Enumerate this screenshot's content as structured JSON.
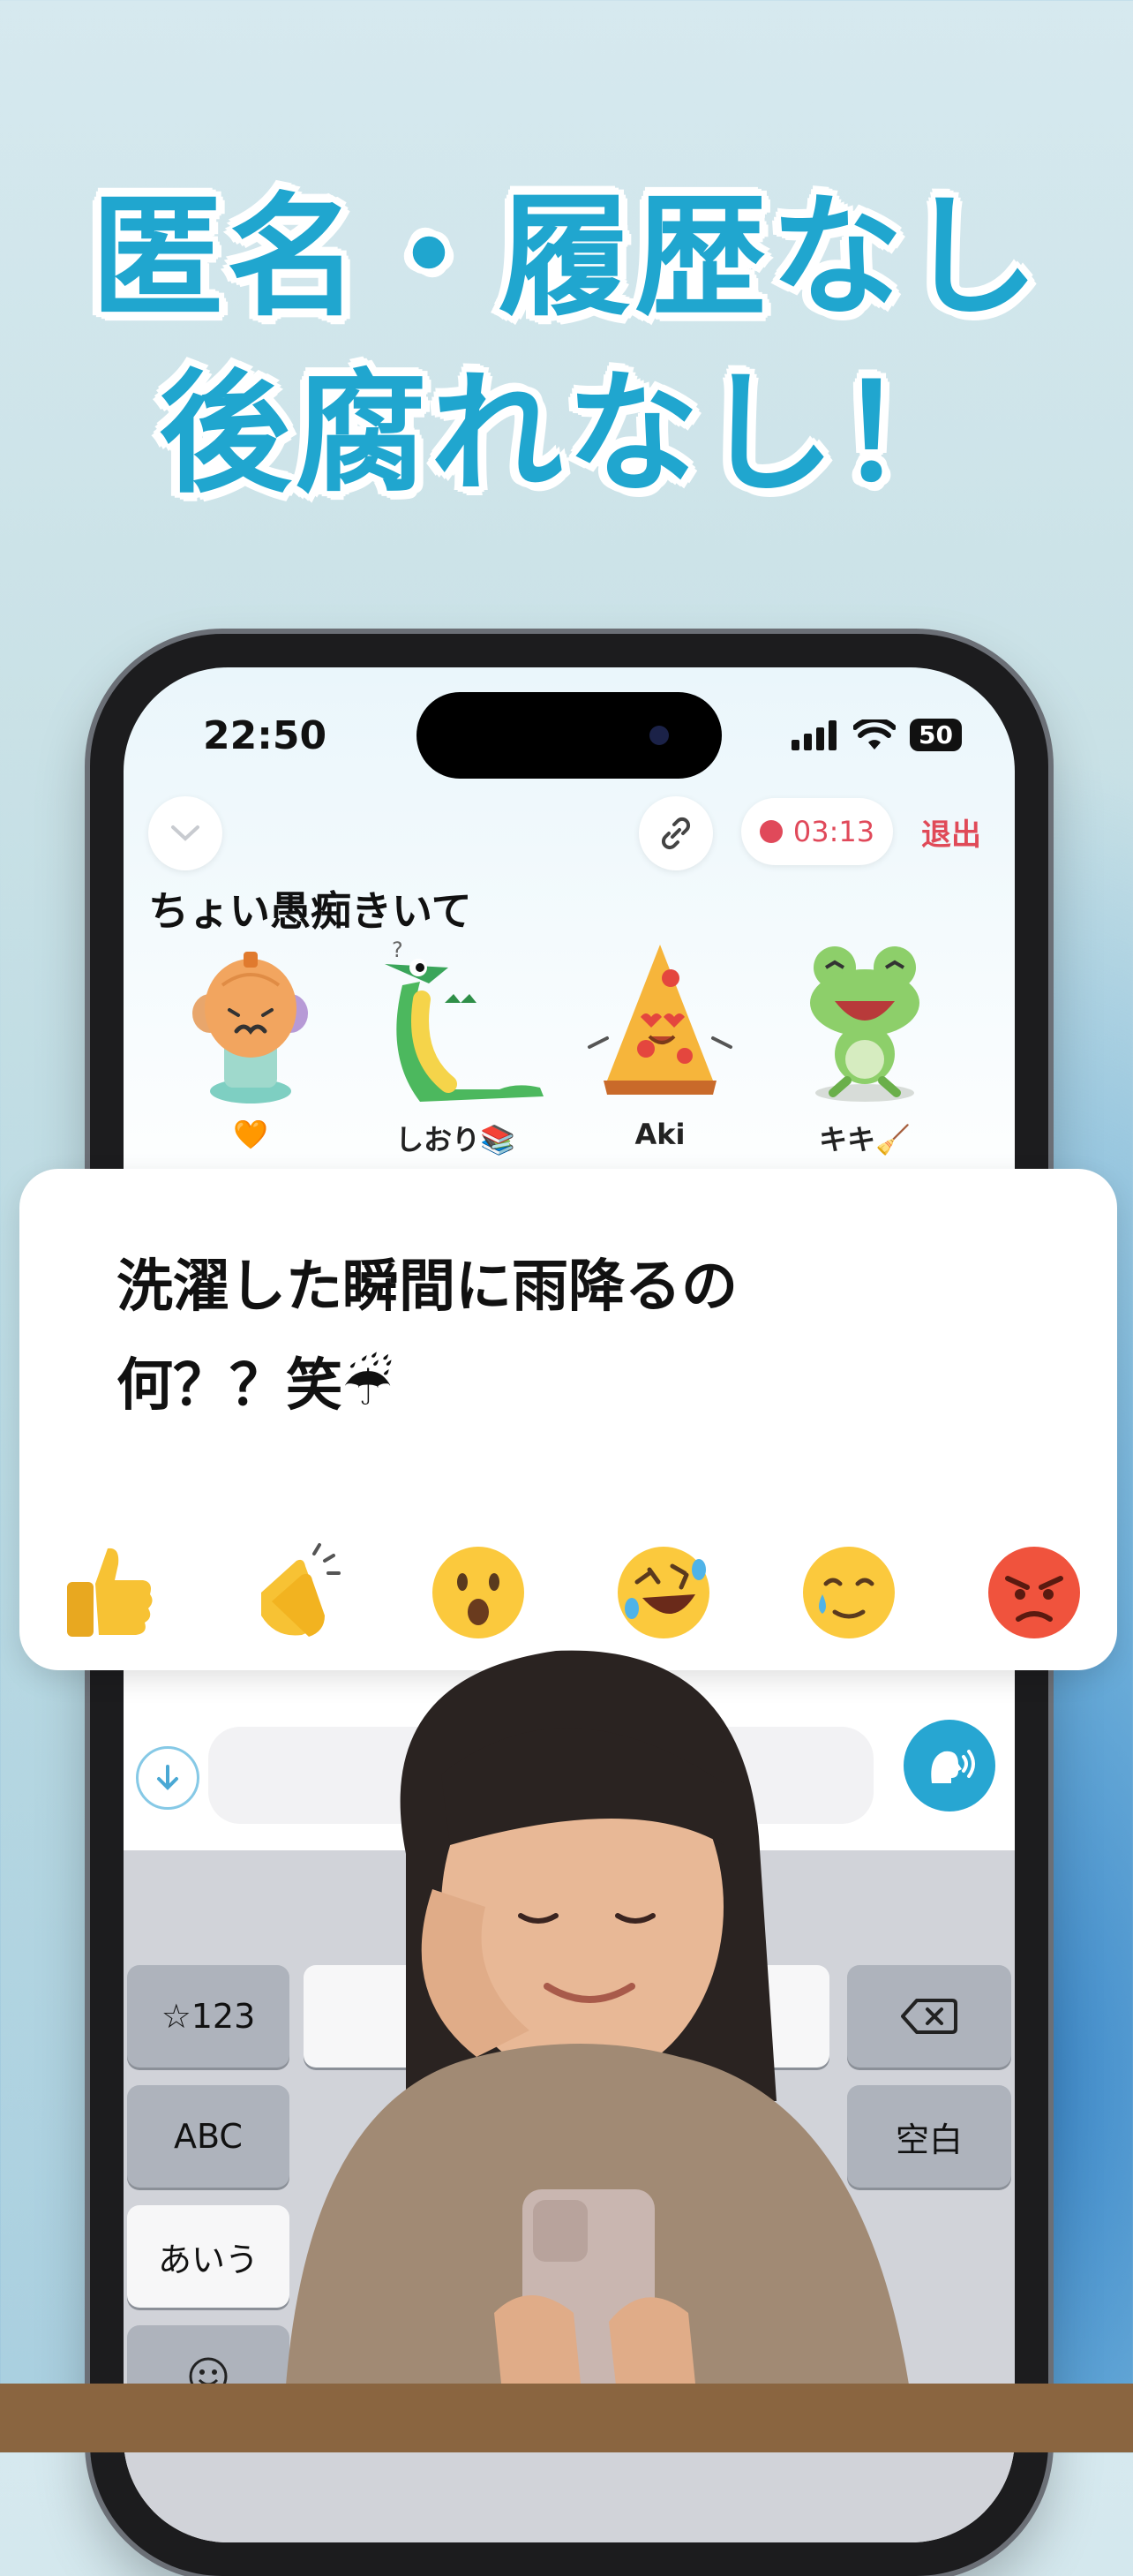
{
  "headline": {
    "line1": "匿名・履歴なし",
    "line2": "後腐れなし！"
  },
  "status_bar": {
    "time": "22:50",
    "battery": "50"
  },
  "room": {
    "title": "ちょい愚痴きいて",
    "recording_time": "03:13",
    "exit_label": "退出",
    "participants": [
      {
        "name": "🧡",
        "icon": "pumpkin-avatar-icon"
      },
      {
        "name": "しおり📚",
        "icon": "crocodile-avatar-icon"
      },
      {
        "name": "Aki",
        "icon": "pizza-avatar-icon"
      },
      {
        "name": "キキ🧹",
        "icon": "frog-avatar-icon"
      }
    ]
  },
  "message": {
    "line1": "洗濯した瞬間に雨降るの",
    "line2": "何？？笑☔"
  },
  "reactions": [
    "👍",
    "👏",
    "😮",
    "🤣",
    "🥲",
    "😡"
  ],
  "keyboard": {
    "key_numbers": "☆123",
    "key_abc": "ABC",
    "key_kana": "あいう",
    "key_space": "空白"
  },
  "colors": {
    "accent": "#20a6cf",
    "record": "#e0495a",
    "exit": "#e04a58"
  }
}
